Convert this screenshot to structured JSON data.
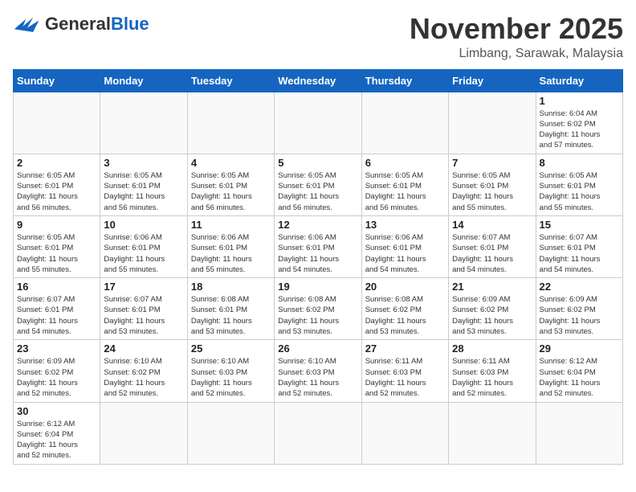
{
  "header": {
    "logo_general": "General",
    "logo_blue": "Blue",
    "month_title": "November 2025",
    "location": "Limbang, Sarawak, Malaysia"
  },
  "weekdays": [
    "Sunday",
    "Monday",
    "Tuesday",
    "Wednesday",
    "Thursday",
    "Friday",
    "Saturday"
  ],
  "weeks": [
    [
      {
        "day": "",
        "info": ""
      },
      {
        "day": "",
        "info": ""
      },
      {
        "day": "",
        "info": ""
      },
      {
        "day": "",
        "info": ""
      },
      {
        "day": "",
        "info": ""
      },
      {
        "day": "",
        "info": ""
      },
      {
        "day": "1",
        "info": "Sunrise: 6:04 AM\nSunset: 6:02 PM\nDaylight: 11 hours\nand 57 minutes."
      }
    ],
    [
      {
        "day": "2",
        "info": "Sunrise: 6:05 AM\nSunset: 6:01 PM\nDaylight: 11 hours\nand 56 minutes."
      },
      {
        "day": "3",
        "info": "Sunrise: 6:05 AM\nSunset: 6:01 PM\nDaylight: 11 hours\nand 56 minutes."
      },
      {
        "day": "4",
        "info": "Sunrise: 6:05 AM\nSunset: 6:01 PM\nDaylight: 11 hours\nand 56 minutes."
      },
      {
        "day": "5",
        "info": "Sunrise: 6:05 AM\nSunset: 6:01 PM\nDaylight: 11 hours\nand 56 minutes."
      },
      {
        "day": "6",
        "info": "Sunrise: 6:05 AM\nSunset: 6:01 PM\nDaylight: 11 hours\nand 56 minutes."
      },
      {
        "day": "7",
        "info": "Sunrise: 6:05 AM\nSunset: 6:01 PM\nDaylight: 11 hours\nand 55 minutes."
      },
      {
        "day": "8",
        "info": "Sunrise: 6:05 AM\nSunset: 6:01 PM\nDaylight: 11 hours\nand 55 minutes."
      }
    ],
    [
      {
        "day": "9",
        "info": "Sunrise: 6:05 AM\nSunset: 6:01 PM\nDaylight: 11 hours\nand 55 minutes."
      },
      {
        "day": "10",
        "info": "Sunrise: 6:06 AM\nSunset: 6:01 PM\nDaylight: 11 hours\nand 55 minutes."
      },
      {
        "day": "11",
        "info": "Sunrise: 6:06 AM\nSunset: 6:01 PM\nDaylight: 11 hours\nand 55 minutes."
      },
      {
        "day": "12",
        "info": "Sunrise: 6:06 AM\nSunset: 6:01 PM\nDaylight: 11 hours\nand 54 minutes."
      },
      {
        "day": "13",
        "info": "Sunrise: 6:06 AM\nSunset: 6:01 PM\nDaylight: 11 hours\nand 54 minutes."
      },
      {
        "day": "14",
        "info": "Sunrise: 6:07 AM\nSunset: 6:01 PM\nDaylight: 11 hours\nand 54 minutes."
      },
      {
        "day": "15",
        "info": "Sunrise: 6:07 AM\nSunset: 6:01 PM\nDaylight: 11 hours\nand 54 minutes."
      }
    ],
    [
      {
        "day": "16",
        "info": "Sunrise: 6:07 AM\nSunset: 6:01 PM\nDaylight: 11 hours\nand 54 minutes."
      },
      {
        "day": "17",
        "info": "Sunrise: 6:07 AM\nSunset: 6:01 PM\nDaylight: 11 hours\nand 53 minutes."
      },
      {
        "day": "18",
        "info": "Sunrise: 6:08 AM\nSunset: 6:01 PM\nDaylight: 11 hours\nand 53 minutes."
      },
      {
        "day": "19",
        "info": "Sunrise: 6:08 AM\nSunset: 6:02 PM\nDaylight: 11 hours\nand 53 minutes."
      },
      {
        "day": "20",
        "info": "Sunrise: 6:08 AM\nSunset: 6:02 PM\nDaylight: 11 hours\nand 53 minutes."
      },
      {
        "day": "21",
        "info": "Sunrise: 6:09 AM\nSunset: 6:02 PM\nDaylight: 11 hours\nand 53 minutes."
      },
      {
        "day": "22",
        "info": "Sunrise: 6:09 AM\nSunset: 6:02 PM\nDaylight: 11 hours\nand 53 minutes."
      }
    ],
    [
      {
        "day": "23",
        "info": "Sunrise: 6:09 AM\nSunset: 6:02 PM\nDaylight: 11 hours\nand 52 minutes."
      },
      {
        "day": "24",
        "info": "Sunrise: 6:10 AM\nSunset: 6:02 PM\nDaylight: 11 hours\nand 52 minutes."
      },
      {
        "day": "25",
        "info": "Sunrise: 6:10 AM\nSunset: 6:03 PM\nDaylight: 11 hours\nand 52 minutes."
      },
      {
        "day": "26",
        "info": "Sunrise: 6:10 AM\nSunset: 6:03 PM\nDaylight: 11 hours\nand 52 minutes."
      },
      {
        "day": "27",
        "info": "Sunrise: 6:11 AM\nSunset: 6:03 PM\nDaylight: 11 hours\nand 52 minutes."
      },
      {
        "day": "28",
        "info": "Sunrise: 6:11 AM\nSunset: 6:03 PM\nDaylight: 11 hours\nand 52 minutes."
      },
      {
        "day": "29",
        "info": "Sunrise: 6:12 AM\nSunset: 6:04 PM\nDaylight: 11 hours\nand 52 minutes."
      }
    ],
    [
      {
        "day": "30",
        "info": "Sunrise: 6:12 AM\nSunset: 6:04 PM\nDaylight: 11 hours\nand 52 minutes."
      },
      {
        "day": "",
        "info": ""
      },
      {
        "day": "",
        "info": ""
      },
      {
        "day": "",
        "info": ""
      },
      {
        "day": "",
        "info": ""
      },
      {
        "day": "",
        "info": ""
      },
      {
        "day": "",
        "info": ""
      }
    ]
  ]
}
